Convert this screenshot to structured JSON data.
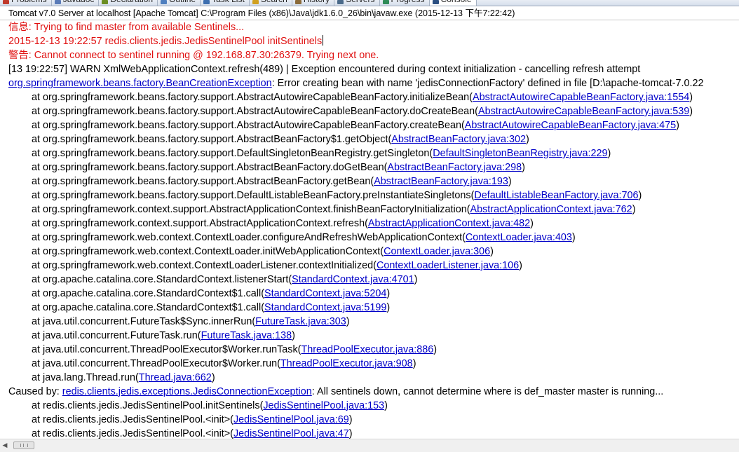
{
  "tabs": [
    {
      "label": "Problems",
      "icon": "problems-icon",
      "color": "#c0392b",
      "active": false
    },
    {
      "label": "Javadoc",
      "icon": "javadoc-icon",
      "color": "#5a7bb8",
      "active": false
    },
    {
      "label": "Declaration",
      "icon": "declaration-icon",
      "color": "#6b8e23",
      "active": false
    },
    {
      "label": "Outline",
      "icon": "outline-icon",
      "color": "#4f7fbf",
      "active": false
    },
    {
      "label": "Task List",
      "icon": "task-list-icon",
      "color": "#3d6fb0",
      "active": false
    },
    {
      "label": "Search",
      "icon": "search-icon",
      "color": "#d0a020",
      "active": false
    },
    {
      "label": "History",
      "icon": "history-icon",
      "color": "#8a6a3a",
      "active": false
    },
    {
      "label": "Servers",
      "icon": "servers-icon",
      "color": "#4a6a8a",
      "active": false
    },
    {
      "label": "Progress",
      "icon": "progress-icon",
      "color": "#2e8b57",
      "active": false
    },
    {
      "label": "Console",
      "icon": "console-icon",
      "color": "#2b4f81",
      "active": true
    }
  ],
  "console_title": "Tomcat v7.0 Server at localhost [Apache Tomcat] C:\\Program Files (x86)\\Java\\jdk1.6.0_26\\bin\\javaw.exe (2015-12-13 下午7:22:42)",
  "lines": [
    {
      "kind": "red",
      "segs": [
        {
          "t": "信息: Trying to find master from available Sentinels..."
        }
      ]
    },
    {
      "kind": "red",
      "caret": true,
      "segs": [
        {
          "t": "2015-12-13 19:22:57 redis.clients.jedis.JedisSentinelPool initSentinels"
        }
      ]
    },
    {
      "kind": "red",
      "segs": [
        {
          "t": "警告: Cannot connect to sentinel running @ 192.168.87.30:26379. Trying next one."
        }
      ]
    },
    {
      "kind": "plain",
      "segs": [
        {
          "t": "[13 19:22:57] WARN XmlWebApplicationContext.refresh(489) | Exception encountered during context initialization - cancelling refresh attempt"
        }
      ]
    },
    {
      "kind": "plain",
      "segs": [
        {
          "t": "org.springframework.beans.factory.BeanCreationException",
          "link": true
        },
        {
          "t": ": Error creating bean with name 'jedisConnectionFactory' defined in file [D:\\apache-tomcat-7.0.22"
        }
      ]
    },
    {
      "kind": "indent",
      "segs": [
        {
          "t": "at org.springframework.beans.factory.support.AbstractAutowireCapableBeanFactory.initializeBean("
        },
        {
          "t": "AbstractAutowireCapableBeanFactory.java:1554",
          "link": true
        },
        {
          "t": ")"
        }
      ]
    },
    {
      "kind": "indent",
      "segs": [
        {
          "t": "at org.springframework.beans.factory.support.AbstractAutowireCapableBeanFactory.doCreateBean("
        },
        {
          "t": "AbstractAutowireCapableBeanFactory.java:539",
          "link": true
        },
        {
          "t": ")"
        }
      ]
    },
    {
      "kind": "indent",
      "segs": [
        {
          "t": "at org.springframework.beans.factory.support.AbstractAutowireCapableBeanFactory.createBean("
        },
        {
          "t": "AbstractAutowireCapableBeanFactory.java:475",
          "link": true
        },
        {
          "t": ")"
        }
      ]
    },
    {
      "kind": "indent",
      "segs": [
        {
          "t": "at org.springframework.beans.factory.support.AbstractBeanFactory$1.getObject("
        },
        {
          "t": "AbstractBeanFactory.java:302",
          "link": true
        },
        {
          "t": ")"
        }
      ]
    },
    {
      "kind": "indent",
      "segs": [
        {
          "t": "at org.springframework.beans.factory.support.DefaultSingletonBeanRegistry.getSingleton("
        },
        {
          "t": "DefaultSingletonBeanRegistry.java:229",
          "link": true
        },
        {
          "t": ")"
        }
      ]
    },
    {
      "kind": "indent",
      "segs": [
        {
          "t": "at org.springframework.beans.factory.support.AbstractBeanFactory.doGetBean("
        },
        {
          "t": "AbstractBeanFactory.java:298",
          "link": true
        },
        {
          "t": ")"
        }
      ]
    },
    {
      "kind": "indent",
      "segs": [
        {
          "t": "at org.springframework.beans.factory.support.AbstractBeanFactory.getBean("
        },
        {
          "t": "AbstractBeanFactory.java:193",
          "link": true
        },
        {
          "t": ")"
        }
      ]
    },
    {
      "kind": "indent",
      "segs": [
        {
          "t": "at org.springframework.beans.factory.support.DefaultListableBeanFactory.preInstantiateSingletons("
        },
        {
          "t": "DefaultListableBeanFactory.java:706",
          "link": true
        },
        {
          "t": ")"
        }
      ]
    },
    {
      "kind": "indent",
      "segs": [
        {
          "t": "at org.springframework.context.support.AbstractApplicationContext.finishBeanFactoryInitialization("
        },
        {
          "t": "AbstractApplicationContext.java:762",
          "link": true
        },
        {
          "t": ")"
        }
      ]
    },
    {
      "kind": "indent",
      "segs": [
        {
          "t": "at org.springframework.context.support.AbstractApplicationContext.refresh("
        },
        {
          "t": "AbstractApplicationContext.java:482",
          "link": true
        },
        {
          "t": ")"
        }
      ]
    },
    {
      "kind": "indent",
      "segs": [
        {
          "t": "at org.springframework.web.context.ContextLoader.configureAndRefreshWebApplicationContext("
        },
        {
          "t": "ContextLoader.java:403",
          "link": true
        },
        {
          "t": ")"
        }
      ]
    },
    {
      "kind": "indent",
      "segs": [
        {
          "t": "at org.springframework.web.context.ContextLoader.initWebApplicationContext("
        },
        {
          "t": "ContextLoader.java:306",
          "link": true
        },
        {
          "t": ")"
        }
      ]
    },
    {
      "kind": "indent",
      "segs": [
        {
          "t": "at org.springframework.web.context.ContextLoaderListener.contextInitialized("
        },
        {
          "t": "ContextLoaderListener.java:106",
          "link": true
        },
        {
          "t": ")"
        }
      ]
    },
    {
      "kind": "indent",
      "segs": [
        {
          "t": "at org.apache.catalina.core.StandardContext.listenerStart("
        },
        {
          "t": "StandardContext.java:4701",
          "link": true
        },
        {
          "t": ")"
        }
      ]
    },
    {
      "kind": "indent",
      "segs": [
        {
          "t": "at org.apache.catalina.core.StandardContext$1.call("
        },
        {
          "t": "StandardContext.java:5204",
          "link": true
        },
        {
          "t": ")"
        }
      ]
    },
    {
      "kind": "indent",
      "segs": [
        {
          "t": "at org.apache.catalina.core.StandardContext$1.call("
        },
        {
          "t": "StandardContext.java:5199",
          "link": true
        },
        {
          "t": ")"
        }
      ]
    },
    {
      "kind": "indent",
      "segs": [
        {
          "t": "at java.util.concurrent.FutureTask$Sync.innerRun("
        },
        {
          "t": "FutureTask.java:303",
          "link": true
        },
        {
          "t": ")"
        }
      ]
    },
    {
      "kind": "indent",
      "segs": [
        {
          "t": "at java.util.concurrent.FutureTask.run("
        },
        {
          "t": "FutureTask.java:138",
          "link": true
        },
        {
          "t": ")"
        }
      ]
    },
    {
      "kind": "indent",
      "segs": [
        {
          "t": "at java.util.concurrent.ThreadPoolExecutor$Worker.runTask("
        },
        {
          "t": "ThreadPoolExecutor.java:886",
          "link": true
        },
        {
          "t": ")"
        }
      ]
    },
    {
      "kind": "indent",
      "segs": [
        {
          "t": "at java.util.concurrent.ThreadPoolExecutor$Worker.run("
        },
        {
          "t": "ThreadPoolExecutor.java:908",
          "link": true
        },
        {
          "t": ")"
        }
      ]
    },
    {
      "kind": "indent",
      "segs": [
        {
          "t": "at java.lang.Thread.run("
        },
        {
          "t": "Thread.java:662",
          "link": true
        },
        {
          "t": ")"
        }
      ]
    },
    {
      "kind": "plain",
      "segs": [
        {
          "t": "Caused by: "
        },
        {
          "t": "redis.clients.jedis.exceptions.JedisConnectionException",
          "link": true
        },
        {
          "t": ": All sentinels down, cannot determine where is def_master master is running..."
        }
      ]
    },
    {
      "kind": "indent",
      "segs": [
        {
          "t": "at redis.clients.jedis.JedisSentinelPool.initSentinels("
        },
        {
          "t": "JedisSentinelPool.java:153",
          "link": true
        },
        {
          "t": ")"
        }
      ]
    },
    {
      "kind": "indent",
      "segs": [
        {
          "t": "at redis.clients.jedis.JedisSentinelPool.<init>("
        },
        {
          "t": "JedisSentinelPool.java:69",
          "link": true
        },
        {
          "t": ")"
        }
      ]
    },
    {
      "kind": "indent",
      "segs": [
        {
          "t": "at redis.clients.jedis.JedisSentinelPool.<init>("
        },
        {
          "t": "JedisSentinelPool.java:47",
          "link": true
        },
        {
          "t": ")"
        }
      ]
    }
  ],
  "scrollbar": {
    "arrow_icon": "scroll-left-arrow-icon",
    "position": 0
  }
}
